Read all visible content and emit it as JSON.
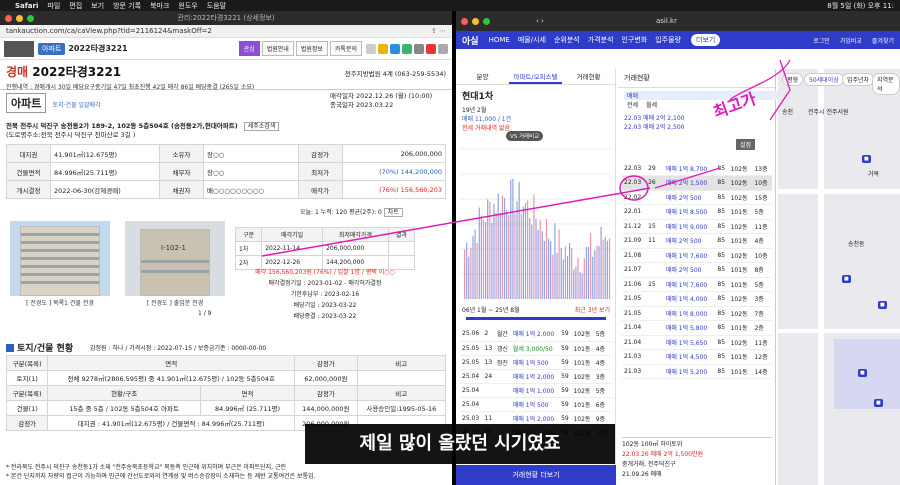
{
  "menubar": {
    "items": [
      "Safari",
      "파일",
      "편집",
      "보기",
      "방문 기록",
      "북마크",
      "윈도우",
      "도움말"
    ],
    "clock": "8월 5일 (화) 오후 11:"
  },
  "left": {
    "window_title": "관리:2022타경3221 (상세정보)",
    "url": "tankauction.com/ca/caView.php?tid=2116124&maskOff=2",
    "header": {
      "type_badge": "아파트",
      "case_no": "2022타경3221",
      "tabs": [
        "관심",
        "법원안내",
        "법원정보",
        "카톡문의"
      ],
      "active_tab": "관심"
    },
    "case": {
      "kind": "경매",
      "number": "2022타경3221",
      "court": "전주지방법원 4계 (063-259-5534)",
      "meta": "진행내역 : 경매개시 30일  배당요구종기일 47일  최초진행 42일  매각 86일  배당종결 (265일 소요)"
    },
    "property_type": "아파트",
    "property_sub": "토지·건물 일괄매각",
    "dates": {
      "sale": "매각일자 2022.12.26 (월) (10:00)",
      "end": "종국일자 2023.03.22"
    },
    "address": [
      "전북 전주시 덕진구 송천동2가 189-2, 102동 5층504호 (송천동2가,현대아파트)",
      "(도로명주소:전북 전주시 덕진구 천마산로 3길 )"
    ],
    "address_btn": "세주소검색",
    "info_rows": [
      {
        "l1": "대지권",
        "v1": "41.901㎡(12.675평)",
        "l2": "소유자",
        "v2": "장○○",
        "l3": "감정가",
        "v3": "206,000,000"
      },
      {
        "l1": "건물면적",
        "v1": "84.996㎡(25.711평)",
        "l2": "채무자",
        "v2": "장○○",
        "l3": "최저가",
        "v3": "(70%) 144,200,000"
      },
      {
        "l1": "개시결정",
        "v1": "2022-06-30(강제경매)",
        "l2": "채권자",
        "v2": "배○○○○○○○○○",
        "l3": "매각가",
        "v3": "(76%) 156,560,203"
      }
    ],
    "view_stats": "오늘: 1  누적: 120  평균(2주): 0",
    "view_btn": "차트",
    "photo_captions": [
      "[ 전경도 ] 목록1 건물 전경",
      "[ 전경도 ] 출입문 전경"
    ],
    "photo_page": "1 / 9",
    "sale_table": {
      "headers": [
        "구분",
        "매각기일",
        "최저매각가격",
        "결과"
      ],
      "rows": [
        [
          "1차",
          "2022-11-14",
          "206,000,000",
          ""
        ],
        [
          "2차",
          "2022-12-26",
          "144,200,000",
          ""
        ]
      ],
      "result": "매각 156,560,203원 (76%) / 입찰 1명 / 평택 이○○",
      "lines": [
        "매각결정기일 : 2023-01-02 - 매각허가결정",
        "기한후납부 : 2023-02-16",
        "배당기일 : 2023-03-22",
        "배당종결 : 2023-03-22"
      ]
    },
    "land": {
      "title": "토지/건물 현황",
      "sub": "감정원 : 하나 / 가격시점 : 2022-07-15 / 보증금기준 : 0000-00-00",
      "headers": [
        "구분(목록)",
        "면적",
        "감정가",
        "비고"
      ],
      "rows": [
        [
          "토지(1)",
          "전체 9278㎡(2806.595평) 중 41.901㎡(12.675평) / 102동 5층504호",
          "62,000,000원",
          ""
        ]
      ],
      "bheaders": [
        "구분(목록)",
        "현황/구조",
        "면적",
        "감정가",
        "비고"
      ],
      "brows": [
        [
          "건물(1)",
          "15층 중 5층 / 102동 5층504호 아파트",
          "84.996㎡ (25.711평)",
          "144,000,000원",
          "사용승인일:1995-05-16"
        ]
      ],
      "total": [
        "감정가",
        "대지권 : 41.901㎡(12.675평) / 건물면적 : 84.996㎡(25.711평)",
        "206,000,000원"
      ]
    },
    "notes": [
      "* 전라북도 전주시 덕진구 송천동1가 소재 \"전주송북초등학교\" 북동측 인근에 위치하며 부근은 아파트단지, 근린",
      "* 본건 단지까지 차량의 접근이 가능하며 인근에 간선도로와의 연계성 및 버스승강장이 소재하는 등 제반 교통여건은 보통임."
    ],
    "status_label": "현황·위치"
  },
  "right": {
    "url": "asil.kr",
    "nav": {
      "brand": "아실",
      "items": [
        "HOME",
        "매물/시세",
        "순위분석",
        "가격분석",
        "인구변화",
        "입주물량"
      ],
      "more": "더보기",
      "icons": [
        "로그인",
        "가입비교",
        "즐겨찾기"
      ]
    },
    "panel": {
      "tabs": [
        "분양",
        "아파트/오피스텔",
        "거래현황"
      ],
      "title": "현대1차",
      "year": "19년 2월",
      "prices": [
        "매매 11,000 / 1건",
        "전세 거래내역 없음"
      ],
      "btn": "VS 거래비교",
      "range": "06년 1월 ~ 25년 8월",
      "range_btn": "최근 3년 보기",
      "tx": [
        [
          "25.06",
          "2",
          "월간",
          "매매 1억 2,000",
          "59",
          "102동",
          "5층"
        ],
        [
          "25.05",
          "13",
          "갱신",
          "월세 3,000/50",
          "59",
          "101동",
          "4층"
        ],
        [
          "25.05",
          "13",
          "정진",
          "매매 1억 500",
          "59",
          "101동",
          "4층"
        ],
        [
          "25.04",
          "24",
          "",
          "매매 1억 2,000",
          "59",
          "102동",
          "3층"
        ],
        [
          "25.04",
          "",
          "",
          "매매 1억 1,000",
          "59",
          "102동",
          "5층"
        ],
        [
          "25.04",
          "",
          "",
          "매매 1억 500",
          "59",
          "101동",
          "6층"
        ],
        [
          "25.03",
          "11",
          "",
          "매매 1억 2,000",
          "59",
          "102동",
          "9층"
        ],
        [
          "25.03",
          "06",
          "",
          "매매 1억 1,500",
          "59",
          "102동",
          "10층"
        ]
      ],
      "bottom_btn": "거래현황 더보기"
    },
    "panel2": {
      "title": "거래현황",
      "chips": [
        "매매",
        "전세",
        "월세"
      ],
      "summary": [
        "22.03 매매 2억 2,100",
        "22.03 매매 2억 2,500"
      ],
      "confirm": "설정",
      "rows": [
        [
          "22.03",
          "29",
          "",
          "매매 1억 8,700",
          "85",
          "102동",
          "13층"
        ],
        [
          "22.03",
          "26",
          "",
          "매매 2억 1,500",
          "85",
          "102동",
          "10층"
        ],
        [
          "22.02",
          "",
          "",
          "매매 2억 500",
          "85",
          "102동",
          "15층"
        ],
        [
          "22.01",
          "",
          "",
          "매매 1억 8,500",
          "85",
          "101동",
          "5층"
        ],
        [
          "21.12",
          "15",
          "",
          "매매 1억 9,000",
          "85",
          "102동",
          "11층"
        ],
        [
          "21.09",
          "11",
          "",
          "매매 2억 500",
          "85",
          "101동",
          "4층"
        ],
        [
          "21.08",
          "",
          "",
          "매매 1억 7,600",
          "85",
          "102동",
          "10층"
        ],
        [
          "21.07",
          "",
          "",
          "매매 2억 500",
          "85",
          "101동",
          "8층"
        ],
        [
          "21.06",
          "15",
          "",
          "매매 1억 7,600",
          "85",
          "101동",
          "5층"
        ],
        [
          "21.05",
          "",
          "",
          "매매 1억 4,000",
          "85",
          "102동",
          "3층"
        ],
        [
          "21.05",
          "",
          "",
          "매매 1억 8,000",
          "85",
          "102동",
          "7층"
        ],
        [
          "21.04",
          "",
          "",
          "매매 1억 5,800",
          "85",
          "101동",
          "2층"
        ],
        [
          "21.04",
          "",
          "",
          "매매 1억 5,650",
          "85",
          "102동",
          "11층"
        ],
        [
          "21.03",
          "",
          "",
          "매매 1억 4,500",
          "85",
          "101동",
          "12층"
        ],
        [
          "21.03",
          "",
          "",
          "매매 1억 5,200",
          "85",
          "101동",
          "14층"
        ]
      ],
      "footer": [
        "102동 100㎡ 하이토위",
        "22.03.26 매매 2억 1,500만원",
        "중개거래, 전주덕진구",
        "21.09.26 매매"
      ]
    },
    "map": {
      "buttons": [
        "평형",
        "50세대이상",
        "입주년차",
        "지역분석"
      ],
      "labels": [
        "송천",
        "전주시 전주서원",
        "송천동",
        "거목"
      ]
    }
  },
  "subtitle": "제일 많이 올랐던 시기였죠",
  "annotation": "최고가"
}
